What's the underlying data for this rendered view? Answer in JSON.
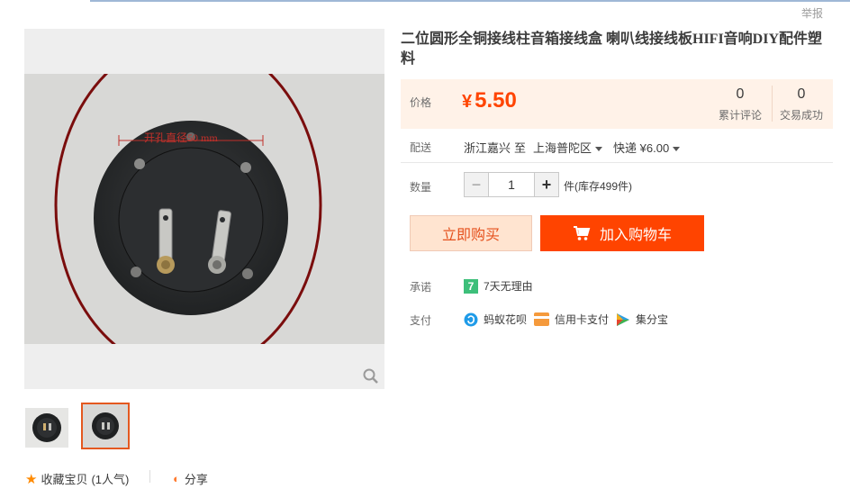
{
  "header": {
    "report_label": "举报"
  },
  "gallery": {
    "main_image_alt": "",
    "annotation_text": "开孔直径50 mm",
    "favorite_label": "收藏宝贝",
    "favorite_count": "(1人气)",
    "share_label": "分享"
  },
  "product": {
    "title": "二位圆形全铜接线柱音箱接线盒 喇叭线接线板HIFI音响DIY配件塑料",
    "price_label": "价格",
    "currency": "¥",
    "price": "5.50",
    "reviews_count": "0",
    "reviews_label": "累计评论",
    "deals_count": "0",
    "deals_label": "交易成功"
  },
  "shipping": {
    "label": "配送",
    "from": "浙江嘉兴",
    "to_word": "至",
    "destination": "上海普陀区",
    "method": "快递 ¥6.00"
  },
  "quantity": {
    "label": "数量",
    "minus": "−",
    "value": "1",
    "plus": "+",
    "unit_stock": "件(库存499件)"
  },
  "actions": {
    "buy_now": "立即购买",
    "add_to_cart": "加入购物车"
  },
  "promise": {
    "label": "承诺",
    "badge": "7",
    "text": "7天无理由"
  },
  "payment": {
    "label": "支付",
    "methods": [
      "蚂蚁花呗",
      "信用卡支付",
      "集分宝"
    ]
  },
  "colors": {
    "accent": "#ff4400",
    "price_bg": "#fff2e8",
    "thumb_border": "#e4581f"
  }
}
